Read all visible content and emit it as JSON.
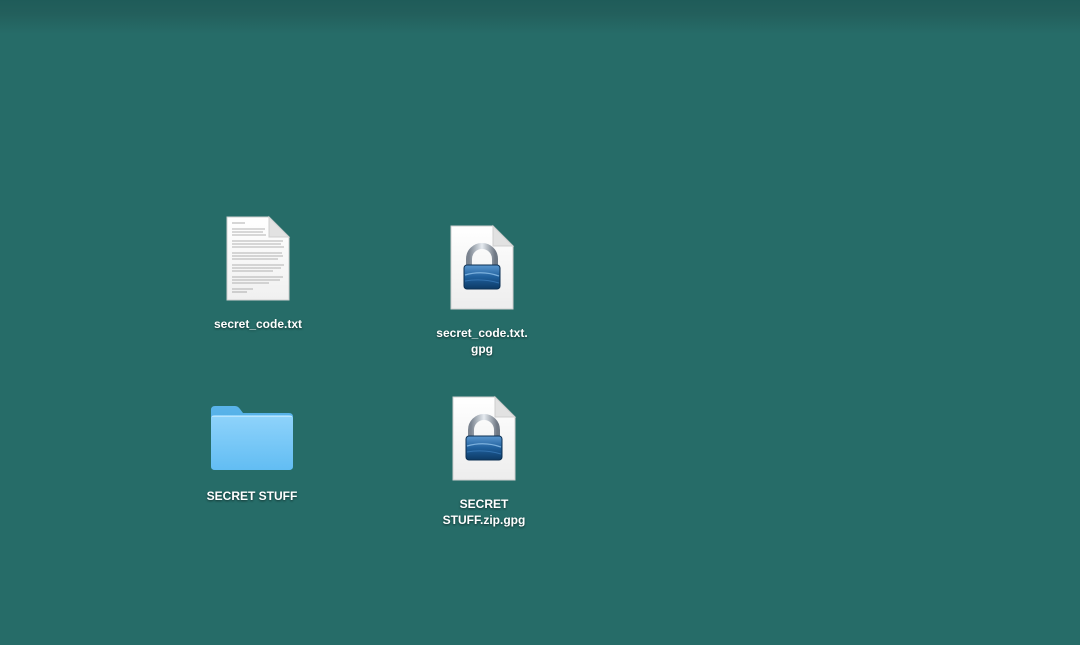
{
  "desktop": {
    "background_color": "#266c68",
    "icons": [
      {
        "label": "secret_code.txt",
        "icon": "text-document-icon"
      },
      {
        "label": "secret_code.txt.\ngpg",
        "icon": "encrypted-file-lock-icon"
      },
      {
        "label": "SECRET STUFF",
        "icon": "folder-icon",
        "color": "#6cc4f5"
      },
      {
        "label": "SECRET\nSTUFF.zip.gpg",
        "icon": "encrypted-file-lock-icon"
      }
    ]
  }
}
